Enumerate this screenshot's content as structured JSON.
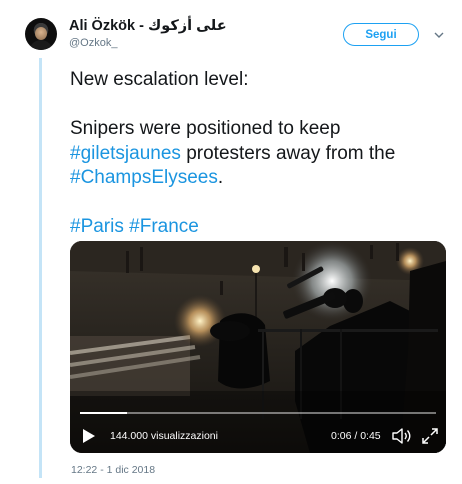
{
  "user": {
    "name": "Ali Özkök - علی أزكوك",
    "handle": "@Ozkok_"
  },
  "follow_button": {
    "label": "Segui"
  },
  "tweet": {
    "line1": "New escalation level:",
    "line2_prefix": "Snipers were positioned to keep",
    "hashtag_gilets": "#giletsjaunes",
    "line3_suffix": " protesters away from the",
    "hashtag_champs": "#ChampsElysees",
    "period": ".",
    "hashtag_paris": "#Paris",
    "hashtag_france": "#France"
  },
  "video": {
    "views": "144.000 visualizzazioni",
    "time": "0:06 / 0:45",
    "progress_fraction": 0.133
  },
  "timestamp": "12:22 - 1 dic 2018",
  "colors": {
    "link": "#1b95e0",
    "accent": "#1da1f2",
    "thread": "#c4e4f7"
  },
  "icons": [
    "play-icon",
    "volume-icon",
    "fullscreen-icon",
    "chevron-down-icon"
  ]
}
